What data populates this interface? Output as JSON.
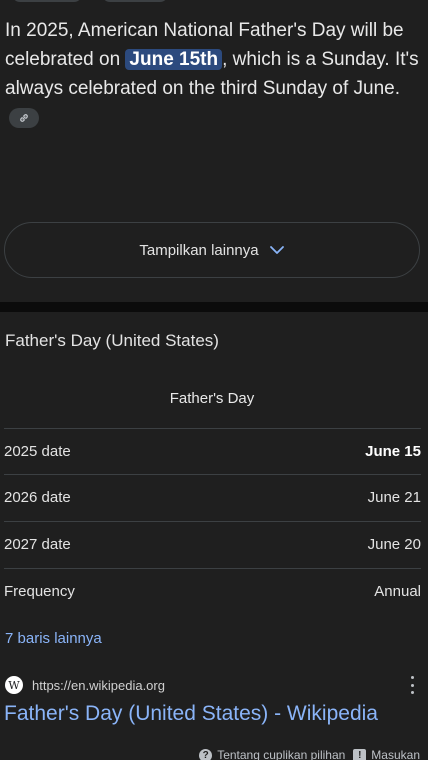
{
  "answer": {
    "text_before": "In 2025, American National Father's Day will be celebrated on ",
    "highlight": "June 15th",
    "text_after": ", which is a Sunday. It's always celebrated on the third Sunday of June."
  },
  "show_more": {
    "label": "Tampilkan lainnya"
  },
  "knowledge": {
    "title": "Father's Day (United States)",
    "caption": "Father's Day",
    "rows": [
      {
        "key": "2025 date",
        "value": "June 15"
      },
      {
        "key": "2026 date",
        "value": "June 21"
      },
      {
        "key": "2027 date",
        "value": "June 20"
      },
      {
        "key": "Frequency",
        "value": "Annual"
      }
    ],
    "more_rows": "7 baris lainnya"
  },
  "source": {
    "favicon": "W",
    "url": "https://en.wikipedia.org",
    "title": "Father's Day (United States) - Wikipedia"
  },
  "footer": {
    "about": "Tentang cuplikan pilihan",
    "feedback": "Masukan"
  },
  "colors": {
    "background": "#1f1f1f",
    "link": "#8ab4f8",
    "highlight": "#2c4a7e"
  }
}
